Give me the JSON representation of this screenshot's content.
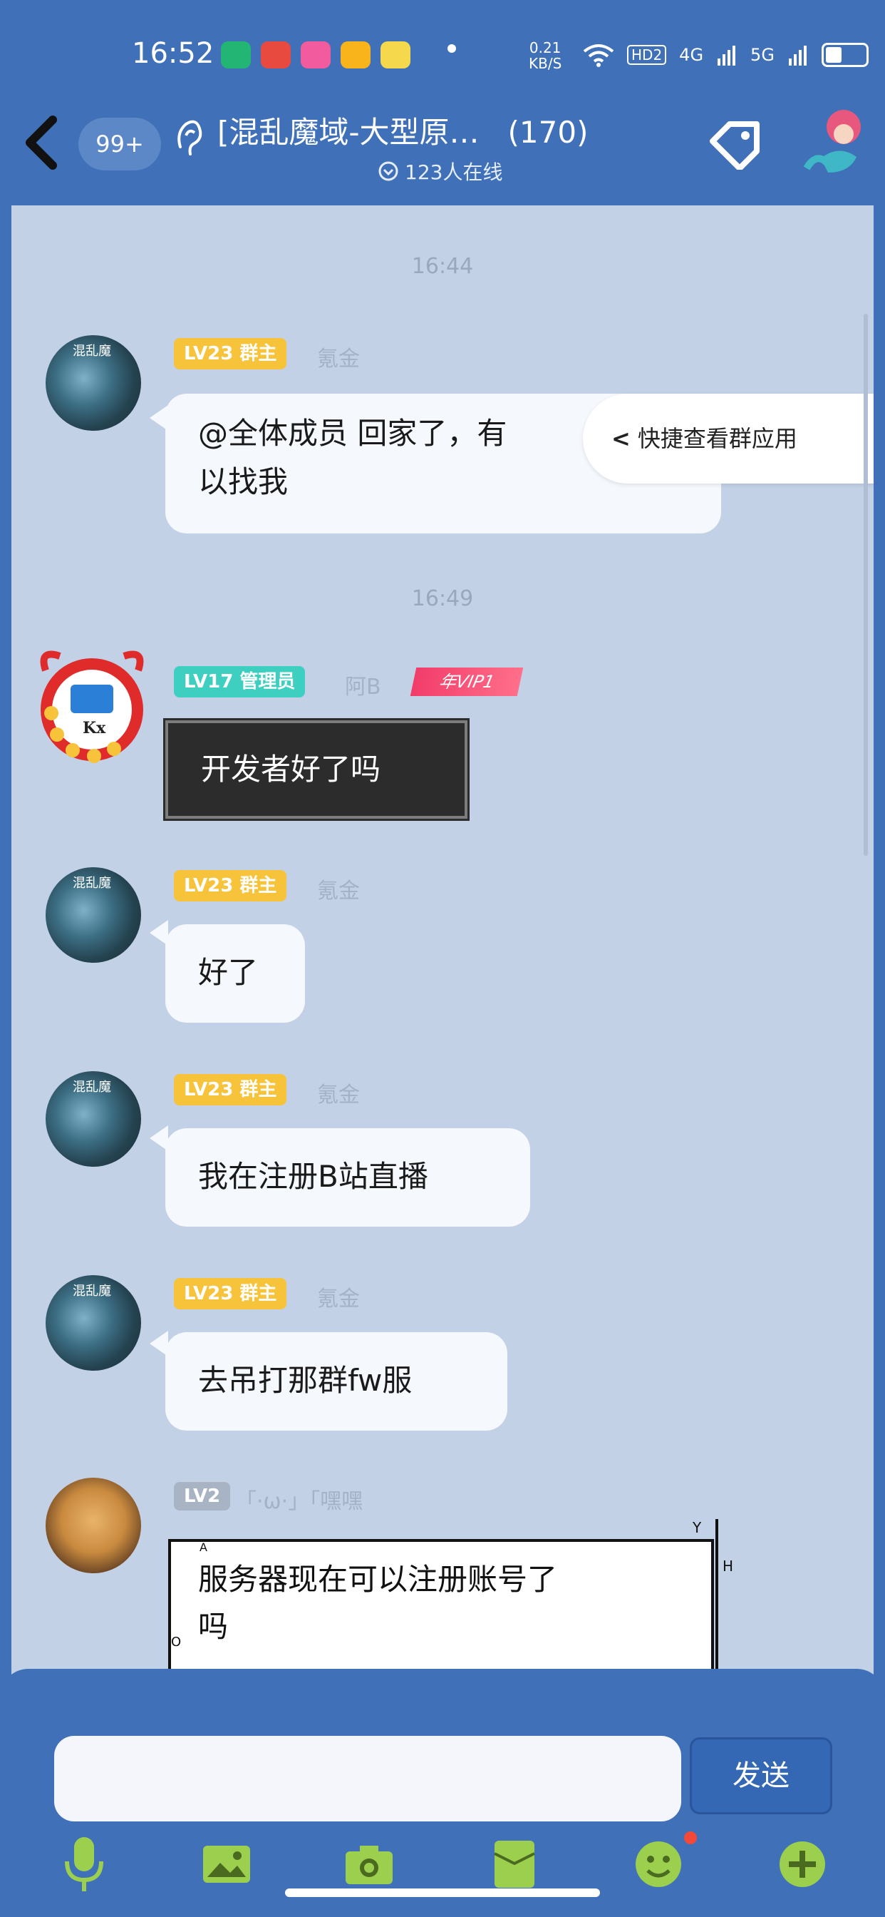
{
  "status_bar": {
    "time": "16:52",
    "net_speed_value": "0.21",
    "net_speed_unit": "KB/S",
    "hd": "HD2",
    "signal1": "4G",
    "signal2": "5G"
  },
  "header": {
    "unread": "99+",
    "title": "[混乱魔域-大型原…",
    "member_count": "(170)",
    "online": "123人在线"
  },
  "quick_view": {
    "label": "快捷查看群应用"
  },
  "messages": [
    {
      "time": "16:44"
    },
    {
      "badge": "LV23 群主",
      "sender": "氪金",
      "text_line1": "@全体成员 回家了，有",
      "text_line2": "以找我"
    },
    {
      "time": "16:49"
    },
    {
      "badge": "LV17 管理员",
      "sender": "阿B",
      "vip": "年VIP1",
      "avatar_text": "Kx",
      "text": "开发者好了吗"
    },
    {
      "badge": "LV23 群主",
      "sender": "氪金",
      "text": "好了"
    },
    {
      "badge": "LV23 群主",
      "sender": "氪金",
      "text": "我在注册B站直播"
    },
    {
      "badge": "LV23 群主",
      "sender": "氪金",
      "text": "去吊打那群fw服"
    },
    {
      "badge": "LV2",
      "sender": "「·ω·」「嘿嘿",
      "text_line1": "服务器现在可以注册账号了",
      "text_line2": "吗",
      "axis_y": "Y",
      "axis_h": "H",
      "axis_a": "A",
      "axis_o": "O"
    }
  ],
  "input": {
    "placeholder": "",
    "send_label": "发送"
  },
  "avatar_caption": "混乱魔",
  "colors": {
    "header": "#3f70b8",
    "chat_bg": "#c3d1e6",
    "owner_badge": "#f6c33b",
    "admin_badge": "#3fcfc0"
  },
  "toolbar_icons": [
    "microphone-icon",
    "image-icon",
    "camera-icon",
    "red-packet-icon",
    "emoji-icon",
    "plus-icon"
  ]
}
